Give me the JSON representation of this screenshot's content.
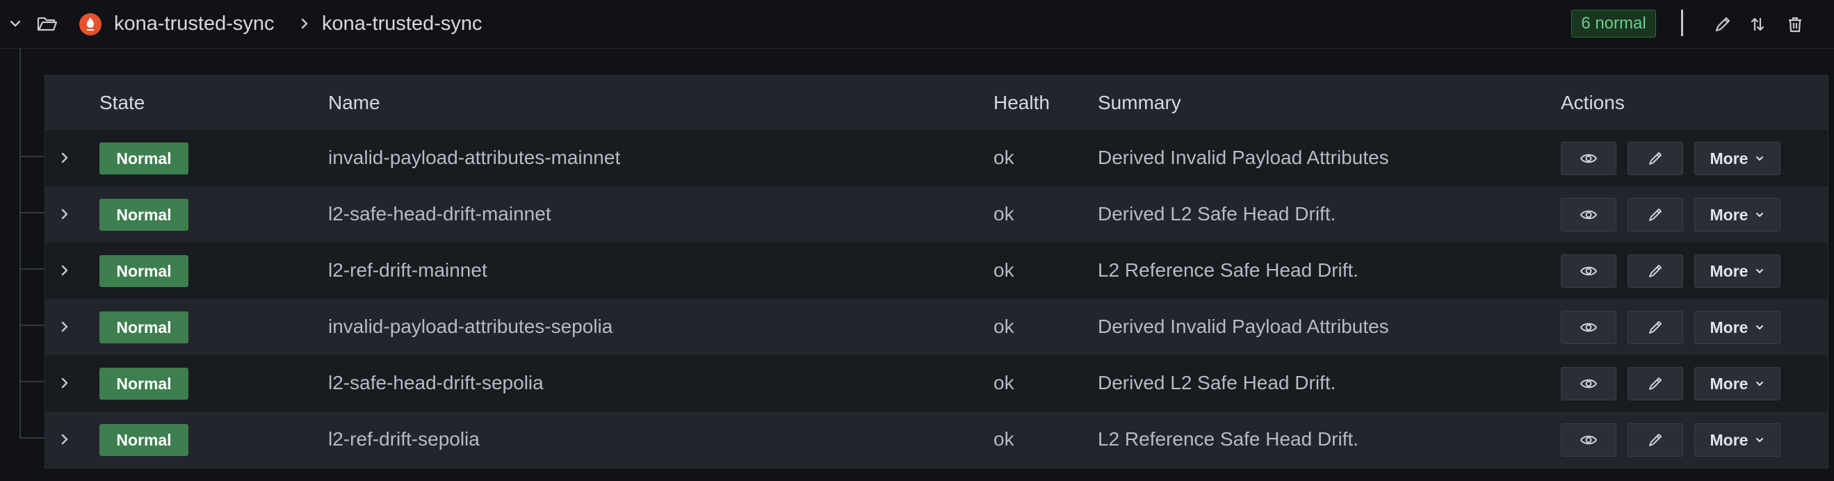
{
  "header": {
    "breadcrumb": [
      "kona-trusted-sync",
      "kona-trusted-sync"
    ],
    "badge": "6 normal"
  },
  "table": {
    "columns": {
      "state": "State",
      "name": "Name",
      "health": "Health",
      "summary": "Summary",
      "actions": "Actions"
    },
    "rows": [
      {
        "state": "Normal",
        "name": "invalid-payload-attributes-mainnet",
        "health": "ok",
        "summary": "Derived Invalid Payload Attributes",
        "more": "More"
      },
      {
        "state": "Normal",
        "name": "l2-safe-head-drift-mainnet",
        "health": "ok",
        "summary": "Derived L2 Safe Head Drift.",
        "more": "More"
      },
      {
        "state": "Normal",
        "name": "l2-ref-drift-mainnet",
        "health": "ok",
        "summary": "L2 Reference Safe Head Drift.",
        "more": "More"
      },
      {
        "state": "Normal",
        "name": "invalid-payload-attributes-sepolia",
        "health": "ok",
        "summary": "Derived Invalid Payload Attributes",
        "more": "More"
      },
      {
        "state": "Normal",
        "name": "l2-safe-head-drift-sepolia",
        "health": "ok",
        "summary": "Derived L2 Safe Head Drift.",
        "more": "More"
      },
      {
        "state": "Normal",
        "name": "l2-ref-drift-sepolia",
        "health": "ok",
        "summary": "L2 Reference Safe Head Drift.",
        "more": "More"
      }
    ]
  },
  "icons": {
    "collapse": "chevron-down-icon",
    "folder": "folder-open-icon",
    "datasource": "prometheus-logo-icon",
    "edit": "pencil-icon",
    "sort": "sort-icon",
    "delete": "trash-icon",
    "expand": "chevron-right-icon",
    "view": "eye-icon"
  },
  "colors": {
    "state_normal": "#3d7f4f",
    "badge_text": "#6ccf8e",
    "prometheus": "#e6522c"
  }
}
